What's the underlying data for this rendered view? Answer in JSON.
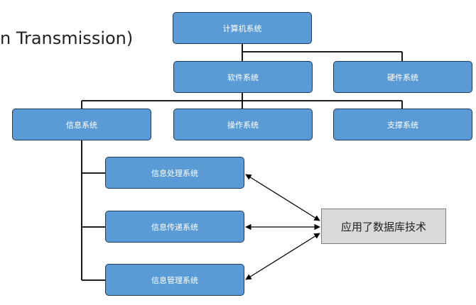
{
  "header_fragment": "n Transmission)",
  "nodes": {
    "computer_system": "计算机系统",
    "software_system": "软件系统",
    "hardware_system": "硬件系统",
    "information_system": "信息系统",
    "operation_system": "操作系统",
    "support_system": "支撑系统",
    "info_processing_system": "信息处理系统",
    "info_transfer_system": "信息传递系统",
    "info_management_system": "信息管理系统"
  },
  "note": "应用了数据库技术",
  "colors": {
    "node_fill": "#5b9bd5",
    "node_border": "#1f3a5a",
    "note_fill": "#d9d9d9",
    "connector": "#000000"
  }
}
